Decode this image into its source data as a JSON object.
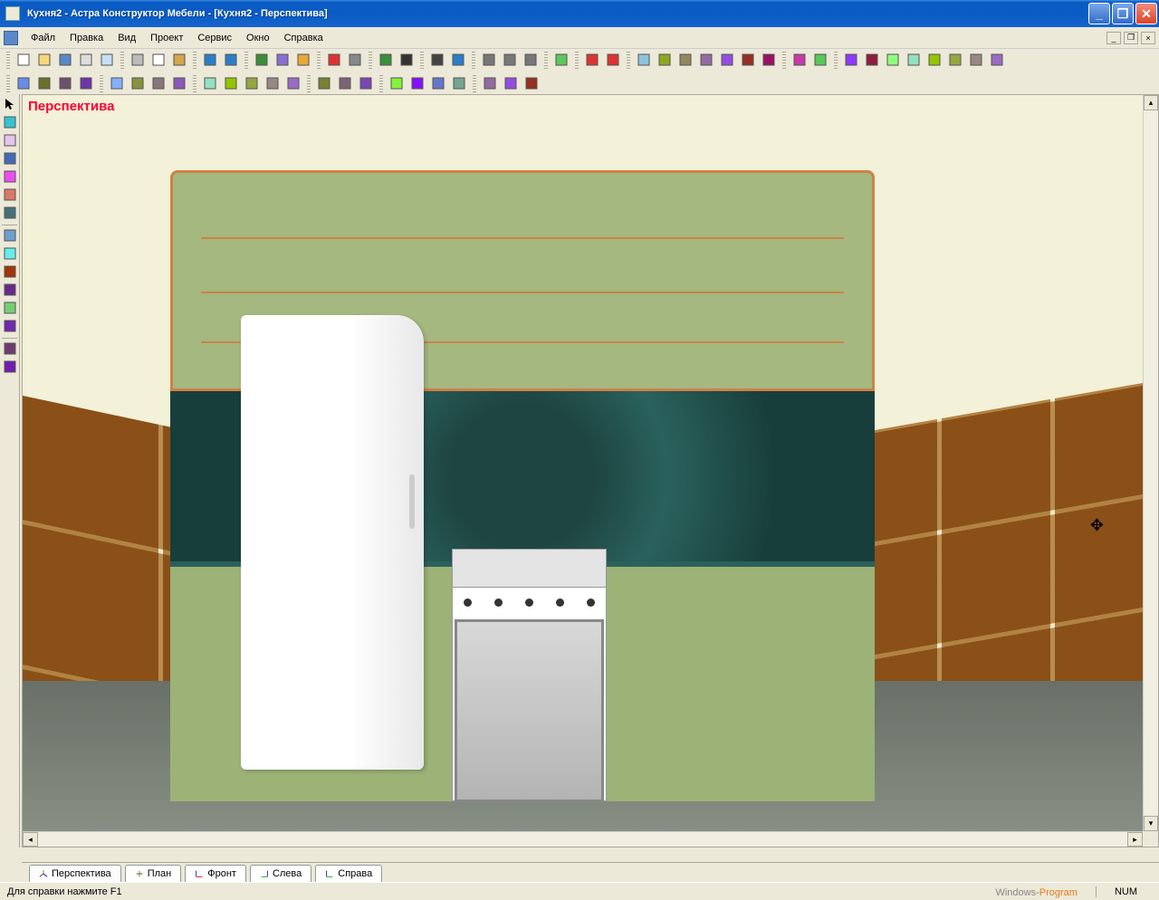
{
  "window": {
    "title": "Кухня2 - Астра Конструктор Мебели - [Кухня2 - Перспектива]"
  },
  "menu": {
    "items": [
      "Файл",
      "Правка",
      "Вид",
      "Проект",
      "Сервис",
      "Окно",
      "Справка"
    ]
  },
  "viewport": {
    "label": "Перспектива"
  },
  "tabs": {
    "items": [
      {
        "label": "Перспектива",
        "icon": "axes3d",
        "active": true
      },
      {
        "label": "План",
        "icon": "plan",
        "active": false
      },
      {
        "label": "Фронт",
        "icon": "front",
        "active": false
      },
      {
        "label": "Слева",
        "icon": "left",
        "active": false
      },
      {
        "label": "Справа",
        "icon": "right",
        "active": false
      }
    ]
  },
  "statusbar": {
    "help_text": "Для справки нажмите F1",
    "watermark_a": "Windows-",
    "watermark_b": "Program",
    "numlock": "NUM"
  },
  "toolbars": {
    "row1_groups": [
      [
        "new",
        "open",
        "save",
        "print",
        "preview"
      ],
      [
        "cut",
        "copy",
        "paste"
      ],
      [
        "undo",
        "redo"
      ],
      [
        "grid",
        "layers",
        "color"
      ],
      [
        "screw-red",
        "screw-gray"
      ],
      [
        "tree",
        "sigma"
      ],
      [
        "camera",
        "help"
      ],
      [
        "zoom-in",
        "zoom-out",
        "zoom-fit"
      ],
      [
        "orbit"
      ],
      [
        "snap1",
        "snap2"
      ],
      [
        "view1",
        "view2",
        "view3",
        "view4",
        "view5",
        "view6",
        "view7"
      ],
      [
        "render1",
        "render2"
      ],
      [
        "win1",
        "win2",
        "win3",
        "win4",
        "win5",
        "win6",
        "win7",
        "win8"
      ]
    ],
    "row2_groups": [
      [
        "dim1",
        "dim2",
        "dim3",
        "dim4"
      ],
      [
        "dimA",
        "dimB",
        "dimC",
        "dimD"
      ],
      [
        "ext1",
        "ext2",
        "ext3",
        "ext4",
        "ext5"
      ],
      [
        "fit1",
        "fit2",
        "fit3"
      ],
      [
        "prim-box",
        "prim-cyl",
        "prim-cone",
        "prim-misc"
      ],
      [
        "tool1",
        "tool2",
        "tool3"
      ]
    ],
    "left_tools": [
      "select",
      "point",
      "rect",
      "poly",
      "oval",
      "line",
      "scissors",
      "sep",
      "t-red",
      "t-orange",
      "t-yellow",
      "t-green",
      "t-cyan",
      "t-blue",
      "sep",
      "measure1",
      "measure2"
    ]
  }
}
